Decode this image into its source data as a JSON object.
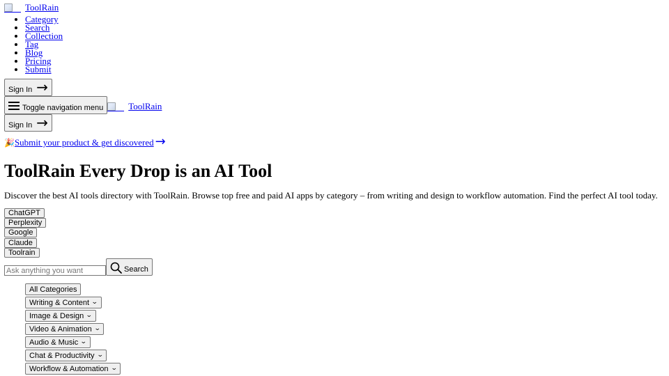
{
  "header": {
    "brand_name": "ToolRain",
    "nav_items": [
      "Category",
      "Search",
      "Collection",
      "Tag",
      "Blog",
      "Pricing",
      "Submit"
    ],
    "sign_in_label": "Sign In",
    "toggle_nav_label": "Toggle navigation menu",
    "mobile_brand_name": "ToolRain",
    "mobile_sign_in_label": "Sign In"
  },
  "promo": {
    "emoji": "🎉",
    "text": "Submit your product & get discovered",
    "arrow_icon": "arrow-right-icon"
  },
  "hero": {
    "title": "ToolRain Every Drop is an AI Tool",
    "description": "Discover the best AI tools directory with ToolRain. Browse top free and paid AI apps by category – from writing and design to workflow automation. Find the perfect AI tool today."
  },
  "quick_chips": [
    "ChatGPT",
    "Perplexity",
    "Google",
    "Claude",
    "Toolrain"
  ],
  "search": {
    "placeholder": "Ask anything you want",
    "value": "",
    "button_label": "Search",
    "icon": "search-icon"
  },
  "categories": [
    {
      "label": "All Categories",
      "has_chevron": false
    },
    {
      "label": "Writing & Content",
      "has_chevron": true
    },
    {
      "label": "Image & Design",
      "has_chevron": true
    },
    {
      "label": "Video & Animation",
      "has_chevron": true
    },
    {
      "label": "Audio & Music",
      "has_chevron": true
    },
    {
      "label": "Chat & Productivity",
      "has_chevron": true
    },
    {
      "label": "Workflow & Automation",
      "has_chevron": true
    }
  ],
  "colors": {
    "link": "#0000ee",
    "button_bg": "#efefef",
    "button_border": "#767676"
  }
}
